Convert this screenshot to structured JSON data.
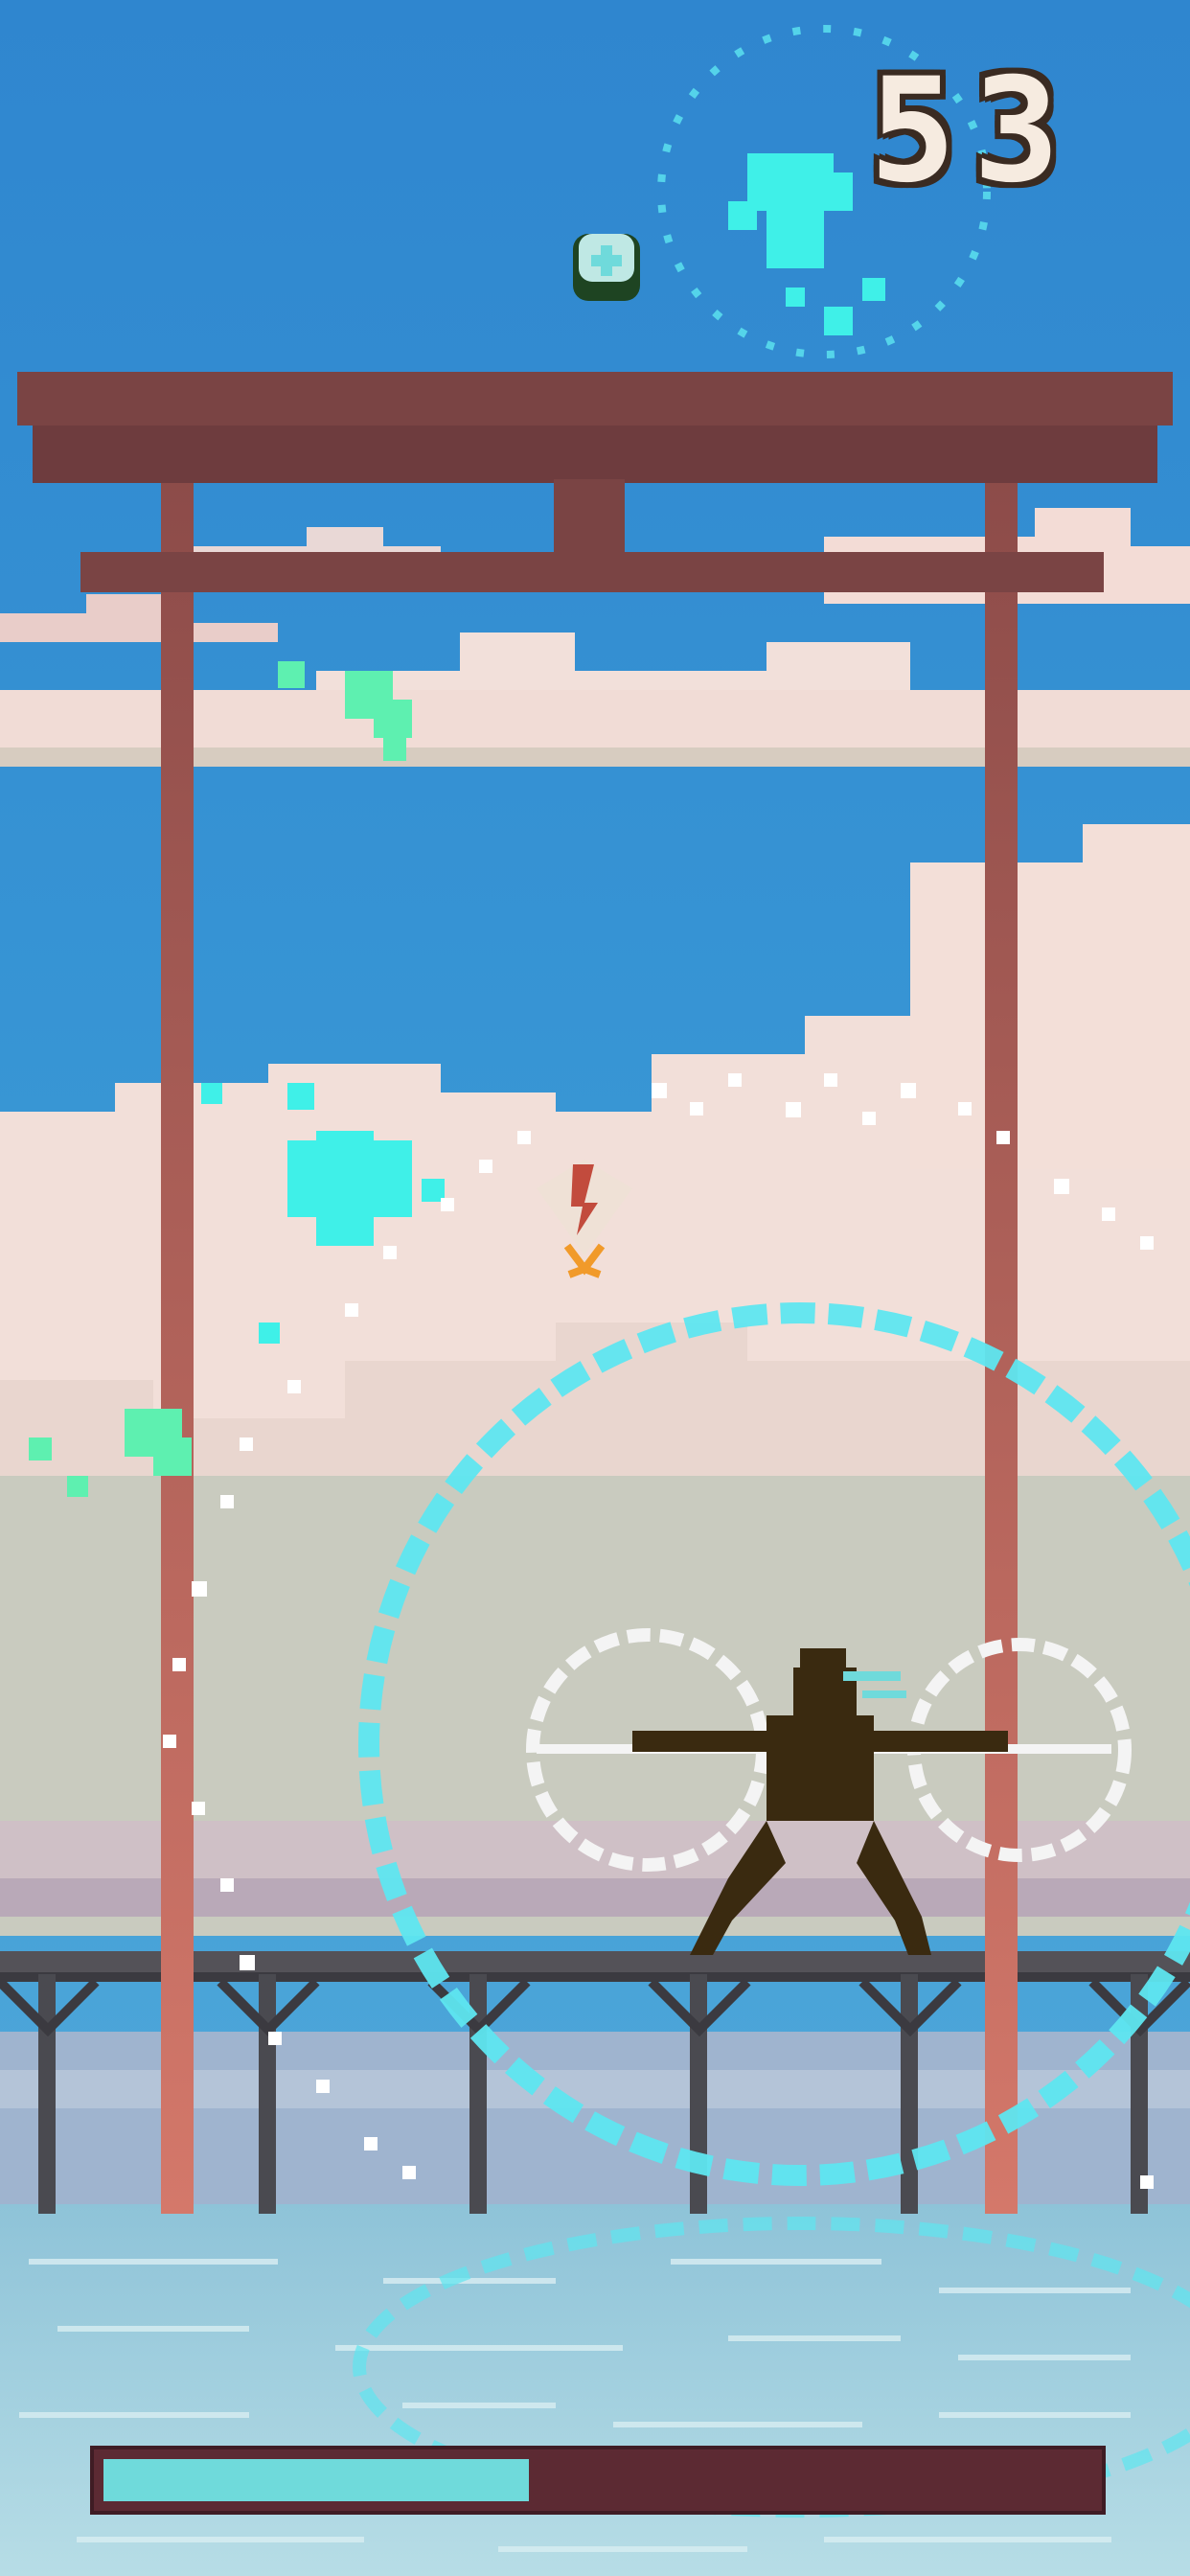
{
  "game": {
    "score": "53",
    "energy_level": 0.43
  },
  "icons": {
    "pickup": "mint-orb-icon",
    "enemy": "paper-fan-kite-icon",
    "player": "ninja-player-icon"
  },
  "colors": {
    "sky": "#2f8ad0",
    "torii": "#7a4444",
    "torii_pillar": "#c46e62",
    "ninja": "#3a2a10",
    "energy_fill": "#6fdadb",
    "energy_track": "#5c2a33",
    "score_text": "#f6ebe0",
    "effect_cyan": "#5ee6f0",
    "effect_green": "#5ef0b0"
  }
}
